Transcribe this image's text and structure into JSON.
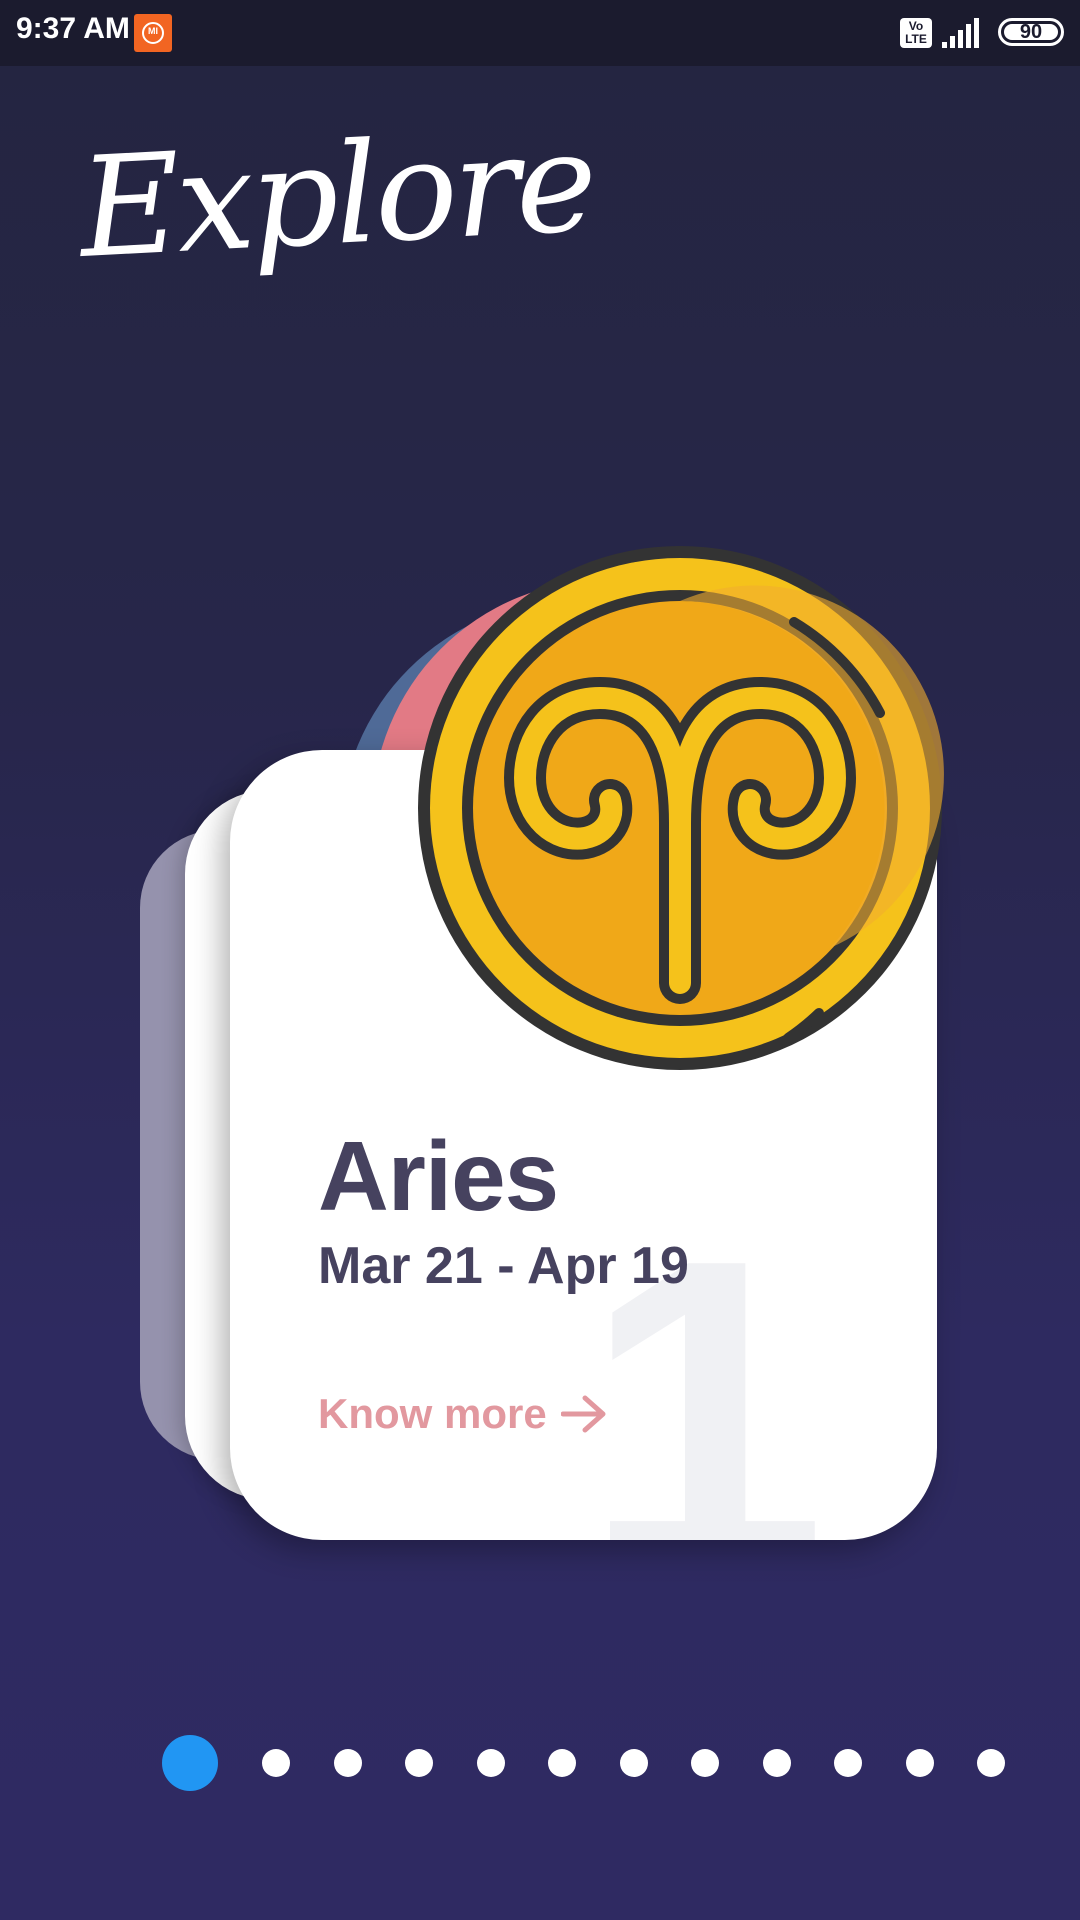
{
  "status_bar": {
    "time": "9:37 AM",
    "network_badge_top": "Vo",
    "network_badge_bottom": "LTE",
    "battery_level": "90",
    "mi_label": "MI"
  },
  "page": {
    "title": "Explore"
  },
  "card": {
    "sign_name": "Aries",
    "date_range": "Mar 21 - Apr 19",
    "number": "1",
    "link_label": "Know more",
    "icon": "aries-symbol-icon",
    "colors": {
      "coin_fill": "#f0a818",
      "coin_rim": "#f5c21b",
      "outline": "#333333",
      "title_text": "#46425f",
      "link_text": "#e2989f"
    }
  },
  "pager": {
    "total": 12,
    "active_index": 0,
    "active_color": "#2196f3"
  }
}
